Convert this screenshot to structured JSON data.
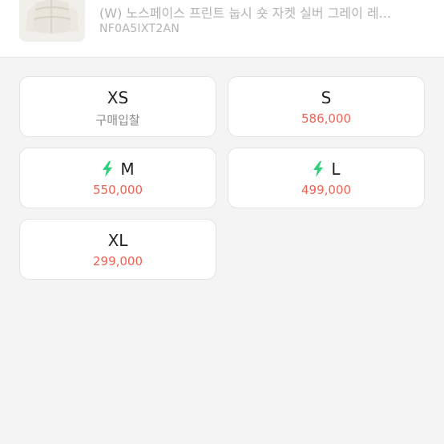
{
  "product": {
    "name": "(W) 노스페이스 프린트 눕시 숏 자켓 실버 그레이 레...",
    "model_code": "NF0A5IXT2AN"
  },
  "sizes": [
    {
      "size": "XS",
      "price": "구매입찰",
      "fast": false,
      "price_style": "gray"
    },
    {
      "size": "S",
      "price": "586,000",
      "fast": false,
      "price_style": "red"
    },
    {
      "size": "M",
      "price": "550,000",
      "fast": true,
      "price_style": "red"
    },
    {
      "size": "L",
      "price": "499,000",
      "fast": true,
      "price_style": "red"
    },
    {
      "size": "XL",
      "price": "299,000",
      "fast": false,
      "price_style": "red"
    }
  ],
  "icons": {
    "fast_delivery": "lightning-bolt-icon"
  },
  "colors": {
    "price": "#ef6253",
    "bolt": "#2fd07a",
    "muted": "#b3b3b3"
  }
}
